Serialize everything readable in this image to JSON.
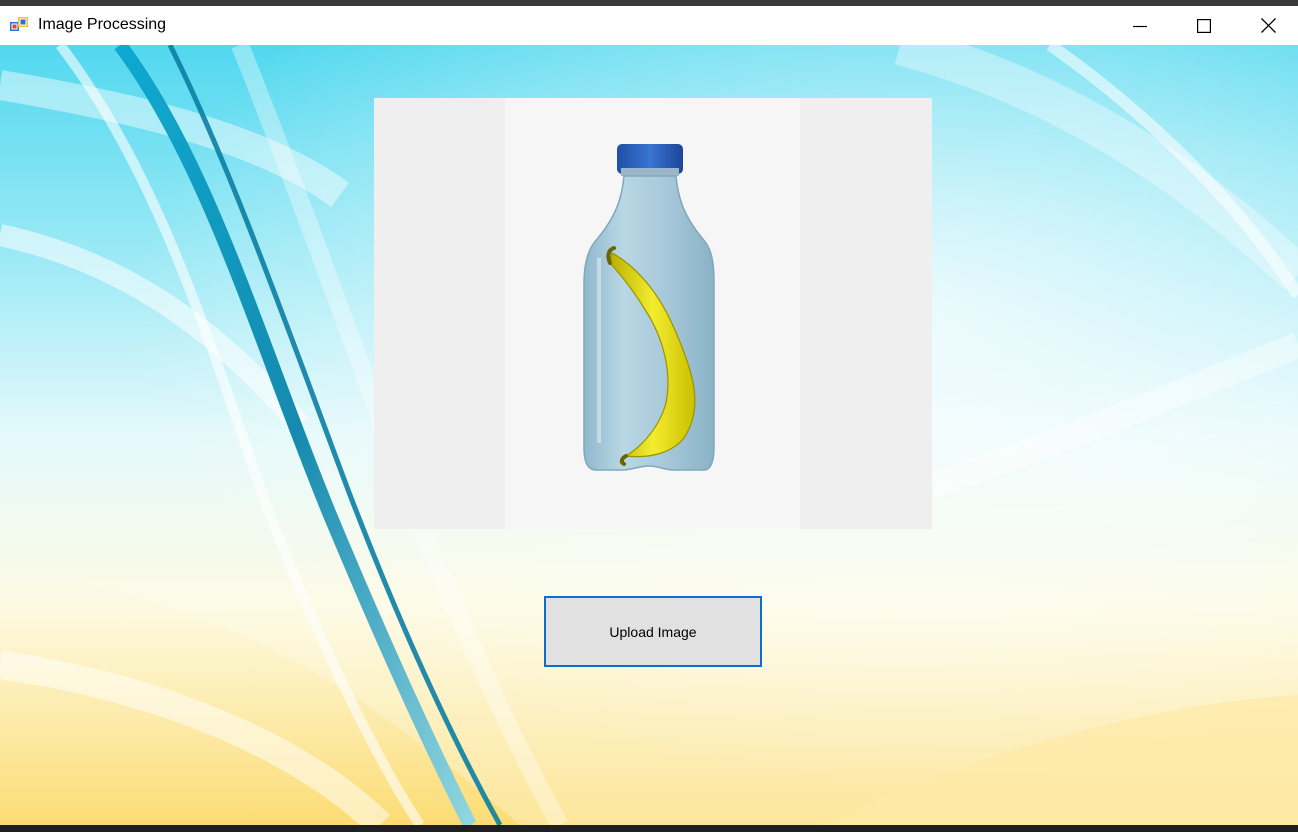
{
  "window": {
    "title": "Image Processing",
    "icon": "windows-form-icon"
  },
  "caption_buttons": {
    "minimize_icon": "minimize-icon",
    "maximize_icon": "maximize-icon",
    "close_icon": "close-icon"
  },
  "picture": {
    "description_icon": "bottle-with-banana-image"
  },
  "upload_button": {
    "label": "Upload Image"
  },
  "colors": {
    "accent_border": "#0a6fd0",
    "button_face": "#e1e1e1",
    "titlebar": "#ffffff"
  }
}
